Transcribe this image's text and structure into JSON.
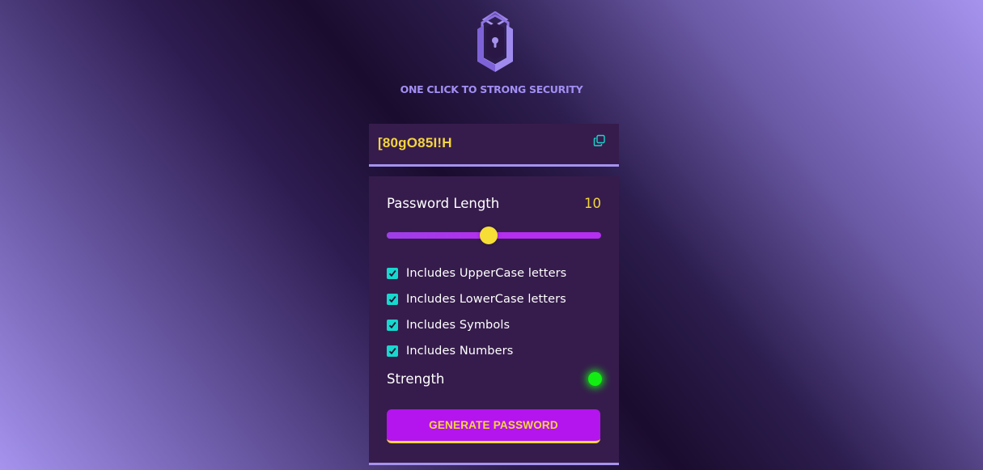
{
  "tagline": "ONE CLICK TO STRONG SECURITY",
  "display": {
    "password": "[80gO85I!H",
    "copy_icon": "copy-icon"
  },
  "length": {
    "label": "Password Length",
    "value": "10",
    "fraction": 0.475
  },
  "options": [
    {
      "label": "Includes UpperCase letters",
      "checked": true
    },
    {
      "label": "Includes LowerCase letters",
      "checked": true
    },
    {
      "label": "Includes Symbols",
      "checked": true
    },
    {
      "label": "Includes Numbers",
      "checked": true
    }
  ],
  "strength": {
    "label": "Strength",
    "color": "#12ee12"
  },
  "generate_label": "GENERATE PASSWORD",
  "colors": {
    "accent": "#a593ee",
    "yellow": "#f4d53d",
    "panel": "#361c4c",
    "button": "#b414ee",
    "checkbox": "#17d8ce"
  }
}
